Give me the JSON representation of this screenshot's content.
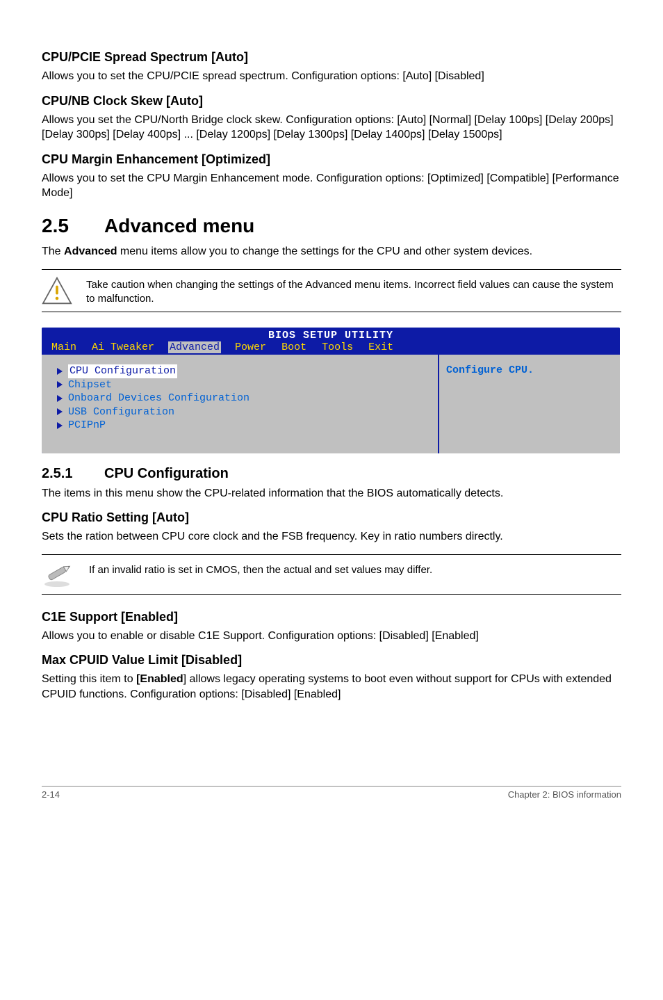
{
  "s1": {
    "h": "CPU/PCIE Spread Spectrum [Auto]",
    "p": "Allows you to set the CPU/PCIE spread spectrum. Configuration options: [Auto] [Disabled]"
  },
  "s2": {
    "h": "CPU/NB Clock Skew [Auto]",
    "p": "Allows you set the CPU/North Bridge clock skew. Configuration options: [Auto] [Normal] [Delay 100ps] [Delay 200ps] [Delay 300ps] [Delay 400ps] ... [Delay 1200ps] [Delay 1300ps] [Delay 1400ps] [Delay 1500ps]"
  },
  "s3": {
    "h": "CPU Margin Enhancement [Optimized]",
    "p": "Allows you to set the CPU Margin Enhancement mode. Configuration options: [Optimized] [Compatible] [Performance Mode]"
  },
  "sec25": {
    "num": "2.5",
    "title": "Advanced menu",
    "intro_a": "The ",
    "intro_bold": "Advanced",
    "intro_b": " menu items allow you to change the settings for the CPU and other system devices."
  },
  "warn1": "Take caution when changing the settings of the Advanced menu items. Incorrect field values can cause the system to malfunction.",
  "bios": {
    "header": "BIOS SETUP UTILITY",
    "tabs": [
      "Main",
      "Ai Tweaker",
      "Advanced",
      "Power",
      "Boot",
      "Tools",
      "Exit"
    ],
    "items": [
      "CPU Configuration",
      "Chipset",
      "Onboard Devices Configuration",
      "USB Configuration",
      "PCIPnP"
    ],
    "right": "Configure CPU."
  },
  "sub251": {
    "num": "2.5.1",
    "title": "CPU Configuration",
    "p": "The items in this menu show the CPU-related information that the BIOS automatically detects."
  },
  "s4": {
    "h": "CPU Ratio Setting [Auto]",
    "p": "Sets the ration between CPU core clock and the FSB frequency. Key in ratio numbers directly."
  },
  "note2": "If an invalid ratio is set in CMOS, then the actual and set values may differ.",
  "s5": {
    "h": "C1E Support [Enabled]",
    "p": "Allows you to enable or disable C1E Support. Configuration options: [Disabled] [Enabled]"
  },
  "s6": {
    "h": "Max CPUID Value Limit [Disabled]",
    "p_a": "Setting this item to ",
    "p_bold": "[Enabled",
    "p_b": "] allows legacy operating systems to boot even without support for CPUs with extended CPUID functions. Configuration options: [Disabled] [Enabled]"
  },
  "footer": {
    "left": "2-14",
    "right": "Chapter 2: BIOS information"
  }
}
